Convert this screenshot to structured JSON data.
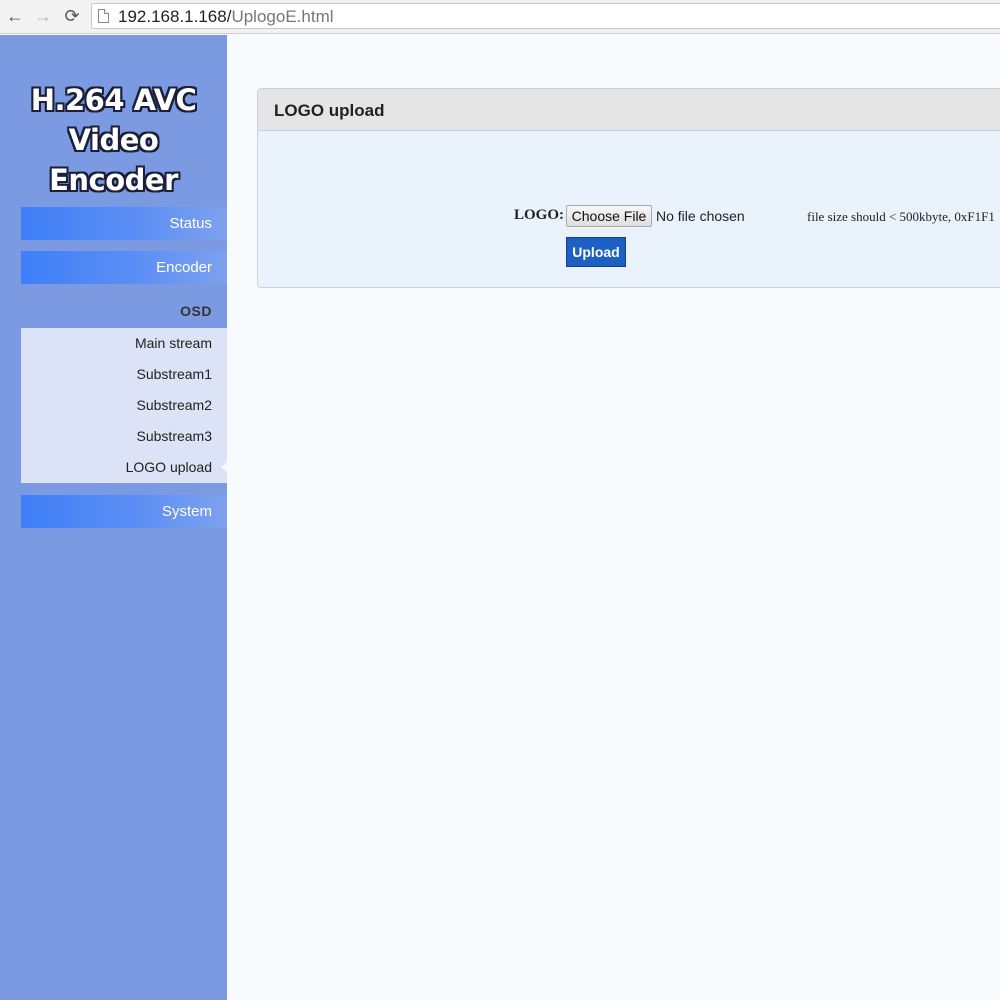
{
  "browser": {
    "back_icon": "←",
    "forward_icon": "→",
    "reload_icon": "⟳",
    "url_host": "192.168.1.168/",
    "url_path": "UplogoE.html"
  },
  "sidebar": {
    "brand_line1": "H.264 AVC",
    "brand_line2": "Video Encoder",
    "status_label": "Status",
    "encoder_label": "Encoder",
    "osd_label": "OSD",
    "osd_items": [
      "Main stream",
      "Substream1",
      "Substream2",
      "Substream3",
      "LOGO upload"
    ],
    "active_item": "LOGO upload",
    "system_label": "System",
    "bg_color": "#7b9ae2"
  },
  "main": {
    "panel_title": "LOGO upload",
    "logo_label": "LOGO:",
    "choose_file_label": "Choose File",
    "file_status": "No file chosen",
    "size_note": "file size should < 500kbyte, 0xF1F1",
    "upload_label": "Upload",
    "upload_color": "#1e5fc4"
  }
}
